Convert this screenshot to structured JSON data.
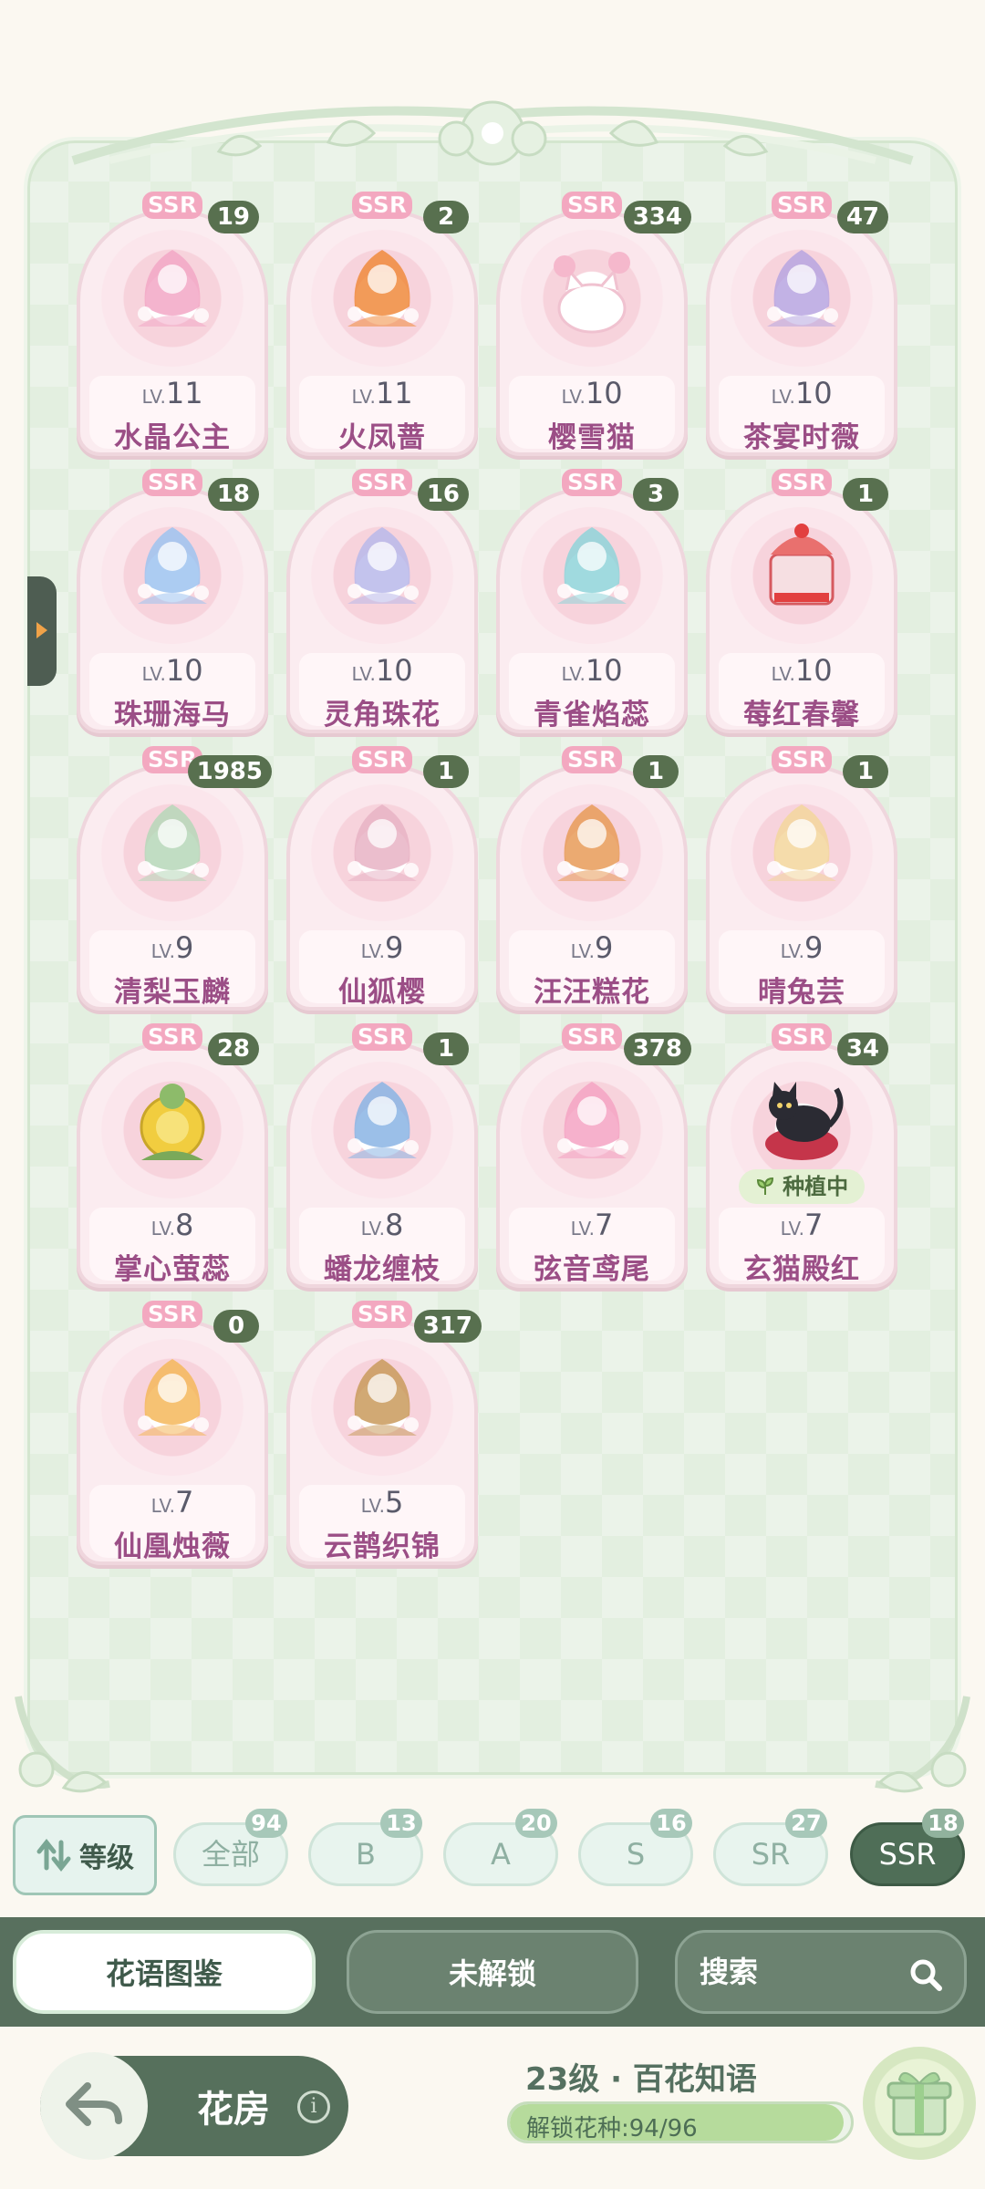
{
  "cards": [
    {
      "rarity": "SSR",
      "count": "19",
      "lv_prefix": "LV.",
      "level": "11",
      "name": "水晶公主",
      "art": "princess",
      "color": "#f2a7c6"
    },
    {
      "rarity": "SSR",
      "count": "2",
      "lv_prefix": "LV.",
      "level": "11",
      "name": "火凤蔷",
      "art": "phoenix",
      "color": "#f08a3c"
    },
    {
      "rarity": "SSR",
      "count": "334",
      "lv_prefix": "LV.",
      "level": "10",
      "name": "樱雪猫",
      "art": "cat",
      "color": "#f5b8cc"
    },
    {
      "rarity": "SSR",
      "count": "47",
      "lv_prefix": "LV.",
      "level": "10",
      "name": "茶宴时薇",
      "art": "girl",
      "color": "#b7a5e0"
    },
    {
      "rarity": "SSR",
      "count": "18",
      "lv_prefix": "LV.",
      "level": "10",
      "name": "珠珊海马",
      "art": "seahorse",
      "color": "#9ec3f0"
    },
    {
      "rarity": "SSR",
      "count": "16",
      "lv_prefix": "LV.",
      "level": "10",
      "name": "灵角珠花",
      "art": "unicorn",
      "color": "#b9b8ea"
    },
    {
      "rarity": "SSR",
      "count": "3",
      "lv_prefix": "LV.",
      "level": "10",
      "name": "青雀焰蕊",
      "art": "peacock",
      "color": "#8fd4d9"
    },
    {
      "rarity": "SSR",
      "count": "1",
      "lv_prefix": "LV.",
      "level": "10",
      "name": "莓红春馨",
      "art": "cake",
      "color": "#e9706e"
    },
    {
      "rarity": "SSR",
      "count": "1985",
      "lv_prefix": "LV.",
      "level": "9",
      "name": "清梨玉麟",
      "art": "qilin",
      "color": "#b6d7b8"
    },
    {
      "rarity": "SSR",
      "count": "1",
      "lv_prefix": "LV.",
      "level": "9",
      "name": "仙狐樱",
      "art": "fox",
      "color": "#e8b3c4"
    },
    {
      "rarity": "SSR",
      "count": "1",
      "lv_prefix": "LV.",
      "level": "9",
      "name": "汪汪糕花",
      "art": "dog",
      "color": "#e79b58"
    },
    {
      "rarity": "SSR",
      "count": "1",
      "lv_prefix": "LV.",
      "level": "9",
      "name": "晴兔芸",
      "art": "rabbit",
      "color": "#f3d69c"
    },
    {
      "rarity": "SSR",
      "count": "28",
      "lv_prefix": "LV.",
      "level": "8",
      "name": "掌心萤蕊",
      "art": "flower",
      "color": "#f1cd3f"
    },
    {
      "rarity": "SSR",
      "count": "1",
      "lv_prefix": "LV.",
      "level": "8",
      "name": "蟠龙缠枝",
      "art": "dragon",
      "color": "#8ab4e4"
    },
    {
      "rarity": "SSR",
      "count": "378",
      "lv_prefix": "LV.",
      "level": "7",
      "name": "弦音鸢尾",
      "art": "harp",
      "color": "#f4a3c3"
    },
    {
      "rarity": "SSR",
      "count": "34",
      "lv_prefix": "LV.",
      "level": "7",
      "name": "玄猫殿红",
      "art": "blackcat",
      "color": "#2b2b33",
      "planting": "种植中"
    },
    {
      "rarity": "SSR",
      "count": "0",
      "lv_prefix": "LV.",
      "level": "7",
      "name": "仙凰烛薇",
      "art": "bird",
      "color": "#f4b75a"
    },
    {
      "rarity": "SSR",
      "count": "317",
      "lv_prefix": "LV.",
      "level": "5",
      "name": "云鹊织锦",
      "art": "lady",
      "color": "#c99a5c"
    }
  ],
  "filters": {
    "sort_label": "等级",
    "chips": [
      {
        "label": "全部",
        "count": "94"
      },
      {
        "label": "B",
        "count": "13"
      },
      {
        "label": "A",
        "count": "20"
      },
      {
        "label": "S",
        "count": "16"
      },
      {
        "label": "SR",
        "count": "27"
      },
      {
        "label": "SSR",
        "count": "18",
        "active": true
      }
    ]
  },
  "tabs": {
    "catalog": "花语图鉴",
    "locked": "未解锁",
    "search_placeholder": "搜索"
  },
  "footer": {
    "greenhouse": "花房",
    "level_title": "23级 · 百花知语",
    "unlock_text": "解锁花种:94/96",
    "unlock_progress": 0.979
  },
  "colors": {
    "primary_green": "#58705e",
    "rarity_pink": "#f3a8c0",
    "name_purple": "#9b4e86"
  }
}
